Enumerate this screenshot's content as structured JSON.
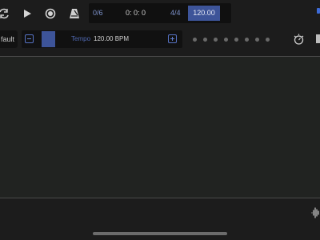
{
  "transport": {
    "position": "0/6",
    "time": "0: 0: 0",
    "time_signature": "4/4",
    "tempo_display": "120.00"
  },
  "toolbar": {
    "preset_label": "fault",
    "tempo_label": "Tempo",
    "tempo_value": "120.00 BPM",
    "beat_dots": 8
  },
  "colors": {
    "accent": "#3d5499",
    "background": "#1c1c1c",
    "panel": "#212321"
  },
  "icons": {
    "loop": "loop-icon",
    "play": "play-icon",
    "record": "record-icon",
    "metronome": "metronome-icon",
    "tuner": "tuner-icon",
    "waveform": "waveform-icon"
  }
}
